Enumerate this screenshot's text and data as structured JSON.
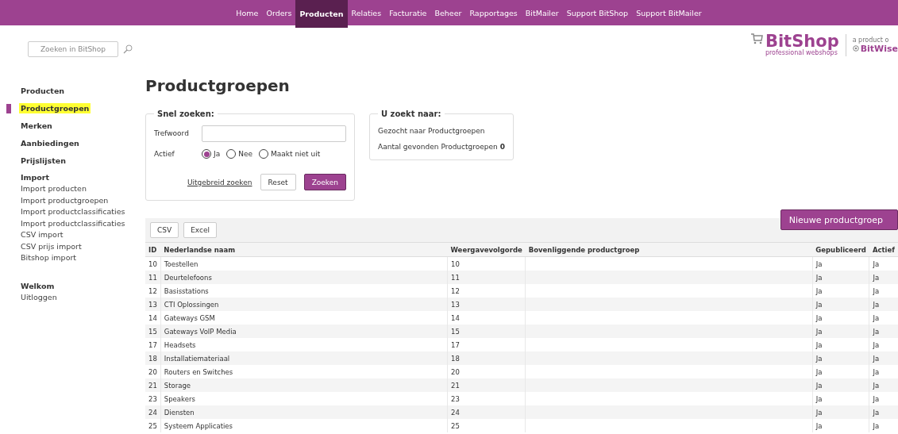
{
  "nav": [
    {
      "label": "Home",
      "selected": false
    },
    {
      "label": "Orders",
      "selected": false
    },
    {
      "label": "Producten",
      "selected": true
    },
    {
      "label": "Relaties",
      "selected": false
    },
    {
      "label": "Facturatie",
      "selected": false
    },
    {
      "label": "Beheer",
      "selected": false
    },
    {
      "label": "Rapportages",
      "selected": false
    },
    {
      "label": "BitMailer",
      "selected": false
    },
    {
      "label": "Support BitShop",
      "selected": false
    },
    {
      "label": "Support BitMailer",
      "selected": false
    }
  ],
  "search": {
    "placeholder": "Zoeken in BitShop"
  },
  "logo": {
    "name": "BitShop",
    "tagline": "professional webshops",
    "byline": "a product o",
    "maker": "BitWise"
  },
  "sidebar": {
    "items": [
      {
        "label": "Producten",
        "selected": false
      },
      {
        "label": "Productgroepen",
        "selected": true
      },
      {
        "label": "Merken",
        "selected": false
      },
      {
        "label": "Aanbiedingen",
        "selected": false
      },
      {
        "label": "Prijslijsten",
        "selected": false
      }
    ],
    "import": {
      "title": "Import",
      "links": [
        "Import producten",
        "Import productgroepen",
        "Import productclassificaties",
        "Import productclassificaties",
        "CSV import",
        "CSV prijs import",
        "Bitshop import"
      ]
    },
    "welcome": "Welkom",
    "logout": "Uitloggen"
  },
  "page_title": "Productgroepen",
  "quick_search": {
    "legend": "Snel zoeken:",
    "keyword_label": "Trefwoord",
    "active_label": "Actief",
    "options": [
      {
        "label": "Ja",
        "selected": true
      },
      {
        "label": "Nee",
        "selected": false
      },
      {
        "label": "Maakt niet uit",
        "selected": false
      }
    ],
    "advanced_link": "Uitgebreid zoeken",
    "reset": "Reset",
    "submit": "Zoeken"
  },
  "search_summary": {
    "legend": "U zoekt naar:",
    "line": "Gezocht naar Productgroepen",
    "count_line": "Aantal gevonden Productgroepen **0**"
  },
  "new_button": "Nieuwe productgroep",
  "export_buttons": [
    "CSV",
    "Excel"
  ],
  "table": {
    "columns": [
      "ID",
      "Nederlandse naam",
      "Weergavevolgorde",
      "Bovenliggende productgroep",
      "Gepubliceerd",
      "Actief"
    ],
    "rows": [
      [
        "10",
        "Toestellen",
        "10",
        "",
        "Ja",
        "Ja"
      ],
      [
        "11",
        "Deurtelefoons",
        "11",
        "",
        "Ja",
        "Ja"
      ],
      [
        "12",
        "Basisstations",
        "12",
        "",
        "Ja",
        "Ja"
      ],
      [
        "13",
        "CTI Oplossingen",
        "13",
        "",
        "Ja",
        "Ja"
      ],
      [
        "14",
        "Gateways GSM",
        "14",
        "",
        "Ja",
        "Ja"
      ],
      [
        "15",
        "Gateways VoIP Media",
        "15",
        "",
        "Ja",
        "Ja"
      ],
      [
        "17",
        "Headsets",
        "17",
        "",
        "Ja",
        "Ja"
      ],
      [
        "18",
        "Installatiemateriaal",
        "18",
        "",
        "Ja",
        "Ja"
      ],
      [
        "20",
        "Routers en Switches",
        "20",
        "",
        "Ja",
        "Ja"
      ],
      [
        "21",
        "Storage",
        "21",
        "",
        "Ja",
        "Ja"
      ],
      [
        "23",
        "Speakers",
        "23",
        "",
        "Ja",
        "Ja"
      ],
      [
        "24",
        "Diensten",
        "24",
        "",
        "Ja",
        "Ja"
      ],
      [
        "25",
        "Systeem Applicaties",
        "25",
        "",
        "Ja",
        "Ja"
      ]
    ]
  }
}
